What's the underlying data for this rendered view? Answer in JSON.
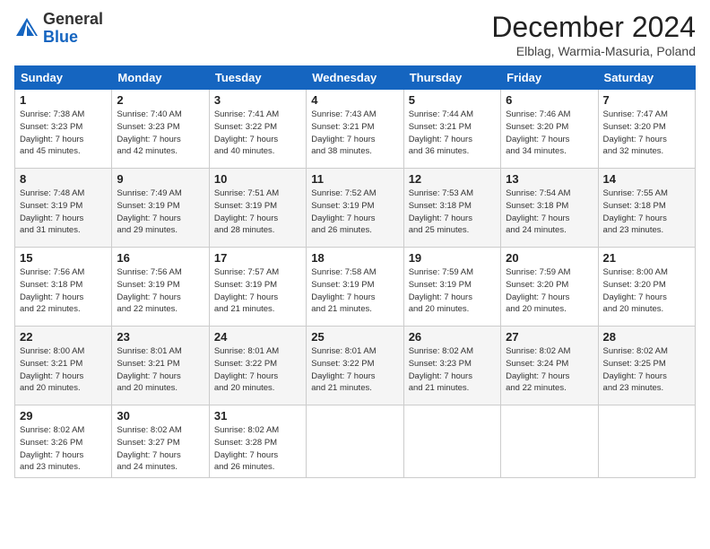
{
  "header": {
    "logo_general": "General",
    "logo_blue": "Blue",
    "month_title": "December 2024",
    "location": "Elblag, Warmia-Masuria, Poland"
  },
  "days_of_week": [
    "Sunday",
    "Monday",
    "Tuesday",
    "Wednesday",
    "Thursday",
    "Friday",
    "Saturday"
  ],
  "weeks": [
    [
      {
        "day": "1",
        "info": "Sunrise: 7:38 AM\nSunset: 3:23 PM\nDaylight: 7 hours\nand 45 minutes."
      },
      {
        "day": "2",
        "info": "Sunrise: 7:40 AM\nSunset: 3:23 PM\nDaylight: 7 hours\nand 42 minutes."
      },
      {
        "day": "3",
        "info": "Sunrise: 7:41 AM\nSunset: 3:22 PM\nDaylight: 7 hours\nand 40 minutes."
      },
      {
        "day": "4",
        "info": "Sunrise: 7:43 AM\nSunset: 3:21 PM\nDaylight: 7 hours\nand 38 minutes."
      },
      {
        "day": "5",
        "info": "Sunrise: 7:44 AM\nSunset: 3:21 PM\nDaylight: 7 hours\nand 36 minutes."
      },
      {
        "day": "6",
        "info": "Sunrise: 7:46 AM\nSunset: 3:20 PM\nDaylight: 7 hours\nand 34 minutes."
      },
      {
        "day": "7",
        "info": "Sunrise: 7:47 AM\nSunset: 3:20 PM\nDaylight: 7 hours\nand 32 minutes."
      }
    ],
    [
      {
        "day": "8",
        "info": "Sunrise: 7:48 AM\nSunset: 3:19 PM\nDaylight: 7 hours\nand 31 minutes."
      },
      {
        "day": "9",
        "info": "Sunrise: 7:49 AM\nSunset: 3:19 PM\nDaylight: 7 hours\nand 29 minutes."
      },
      {
        "day": "10",
        "info": "Sunrise: 7:51 AM\nSunset: 3:19 PM\nDaylight: 7 hours\nand 28 minutes."
      },
      {
        "day": "11",
        "info": "Sunrise: 7:52 AM\nSunset: 3:19 PM\nDaylight: 7 hours\nand 26 minutes."
      },
      {
        "day": "12",
        "info": "Sunrise: 7:53 AM\nSunset: 3:18 PM\nDaylight: 7 hours\nand 25 minutes."
      },
      {
        "day": "13",
        "info": "Sunrise: 7:54 AM\nSunset: 3:18 PM\nDaylight: 7 hours\nand 24 minutes."
      },
      {
        "day": "14",
        "info": "Sunrise: 7:55 AM\nSunset: 3:18 PM\nDaylight: 7 hours\nand 23 minutes."
      }
    ],
    [
      {
        "day": "15",
        "info": "Sunrise: 7:56 AM\nSunset: 3:18 PM\nDaylight: 7 hours\nand 22 minutes."
      },
      {
        "day": "16",
        "info": "Sunrise: 7:56 AM\nSunset: 3:19 PM\nDaylight: 7 hours\nand 22 minutes."
      },
      {
        "day": "17",
        "info": "Sunrise: 7:57 AM\nSunset: 3:19 PM\nDaylight: 7 hours\nand 21 minutes."
      },
      {
        "day": "18",
        "info": "Sunrise: 7:58 AM\nSunset: 3:19 PM\nDaylight: 7 hours\nand 21 minutes."
      },
      {
        "day": "19",
        "info": "Sunrise: 7:59 AM\nSunset: 3:19 PM\nDaylight: 7 hours\nand 20 minutes."
      },
      {
        "day": "20",
        "info": "Sunrise: 7:59 AM\nSunset: 3:20 PM\nDaylight: 7 hours\nand 20 minutes."
      },
      {
        "day": "21",
        "info": "Sunrise: 8:00 AM\nSunset: 3:20 PM\nDaylight: 7 hours\nand 20 minutes."
      }
    ],
    [
      {
        "day": "22",
        "info": "Sunrise: 8:00 AM\nSunset: 3:21 PM\nDaylight: 7 hours\nand 20 minutes."
      },
      {
        "day": "23",
        "info": "Sunrise: 8:01 AM\nSunset: 3:21 PM\nDaylight: 7 hours\nand 20 minutes."
      },
      {
        "day": "24",
        "info": "Sunrise: 8:01 AM\nSunset: 3:22 PM\nDaylight: 7 hours\nand 20 minutes."
      },
      {
        "day": "25",
        "info": "Sunrise: 8:01 AM\nSunset: 3:22 PM\nDaylight: 7 hours\nand 21 minutes."
      },
      {
        "day": "26",
        "info": "Sunrise: 8:02 AM\nSunset: 3:23 PM\nDaylight: 7 hours\nand 21 minutes."
      },
      {
        "day": "27",
        "info": "Sunrise: 8:02 AM\nSunset: 3:24 PM\nDaylight: 7 hours\nand 22 minutes."
      },
      {
        "day": "28",
        "info": "Sunrise: 8:02 AM\nSunset: 3:25 PM\nDaylight: 7 hours\nand 23 minutes."
      }
    ],
    [
      {
        "day": "29",
        "info": "Sunrise: 8:02 AM\nSunset: 3:26 PM\nDaylight: 7 hours\nand 23 minutes."
      },
      {
        "day": "30",
        "info": "Sunrise: 8:02 AM\nSunset: 3:27 PM\nDaylight: 7 hours\nand 24 minutes."
      },
      {
        "day": "31",
        "info": "Sunrise: 8:02 AM\nSunset: 3:28 PM\nDaylight: 7 hours\nand 26 minutes."
      },
      {
        "day": "",
        "info": ""
      },
      {
        "day": "",
        "info": ""
      },
      {
        "day": "",
        "info": ""
      },
      {
        "day": "",
        "info": ""
      }
    ]
  ]
}
